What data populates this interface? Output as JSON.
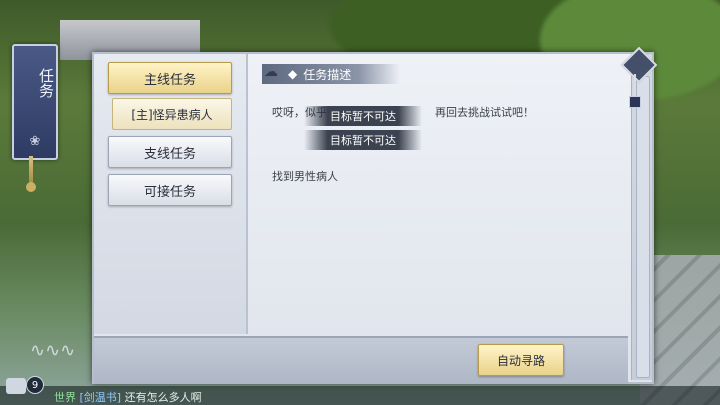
{
  "side_tab": {
    "title": "任务"
  },
  "tabs": [
    {
      "label": "主线任务",
      "active": true
    },
    {
      "label": "[主]怪异患病人",
      "sub": true
    },
    {
      "label": "支线任务",
      "active": false
    },
    {
      "label": "可接任务",
      "active": false
    }
  ],
  "description": {
    "header": "任务描述",
    "text": "哎呀，似乎",
    "text_tail": "再回去挑战试试吧！",
    "goal": "找到男性病人"
  },
  "toasts": [
    "目标暂不可达",
    "目标暂不可达"
  ],
  "buttons": {
    "auto_path": "自动寻路"
  },
  "chat": {
    "count": "9",
    "channel": "世界",
    "name": "[剑温书]",
    "message": "还有怎么多人啊"
  }
}
